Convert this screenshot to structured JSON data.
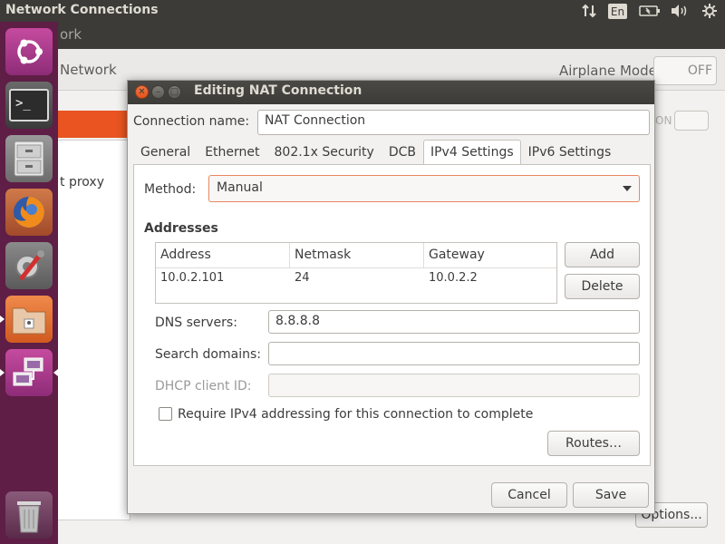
{
  "topbar": {
    "app_title": "Network Connections",
    "tray_icons": [
      "network-updown-icon",
      "battery-icon",
      "volume-icon",
      "gear-icon"
    ],
    "language": "En"
  },
  "launcher": {
    "items": [
      "ubuntu-dash",
      "terminal",
      "file-cabinet",
      "firefox",
      "system-settings",
      "file-manager",
      "network-connections",
      "trash"
    ]
  },
  "background_window": {
    "header_partial": "ork",
    "network_title": "Network",
    "airplane_mode_label": "Airplane Mode",
    "airplane_toggle": "OFF",
    "on_toggle_partial": "ON",
    "proxy_partial": "t proxy",
    "options_button": "Options..."
  },
  "dialog": {
    "title": "Editing NAT Connection",
    "connection_name_label": "Connection name:",
    "connection_name_value": "NAT Connection",
    "tabs": [
      "General",
      "Ethernet",
      "802.1x Security",
      "DCB",
      "IPv4 Settings",
      "IPv6 Settings"
    ],
    "active_tab": "IPv4 Settings",
    "method_label": "Method:",
    "method_value": "Manual",
    "addresses_heading": "Addresses",
    "address_table": {
      "columns": [
        "Address",
        "Netmask",
        "Gateway"
      ],
      "rows": [
        [
          "10.0.2.101",
          "24",
          "10.0.2.2"
        ]
      ]
    },
    "add_button": "Add",
    "delete_button": "Delete",
    "dns_label": "DNS servers:",
    "dns_value": "8.8.8.8",
    "search_domains_label": "Search domains:",
    "search_domains_value": "",
    "dhcp_client_id_label": "DHCP client ID:",
    "dhcp_client_id_value": "",
    "require_ipv4_label": "Require IPv4 addressing for this connection to complete",
    "require_ipv4_checked": false,
    "routes_button": "Routes…",
    "cancel_button": "Cancel",
    "save_button": "Save"
  },
  "colors": {
    "launcher_bg": "#5e1e45",
    "topbar_bg": "#3c3b37",
    "accent_orange": "#e95420",
    "dialog_bg": "#f2f1f0"
  }
}
